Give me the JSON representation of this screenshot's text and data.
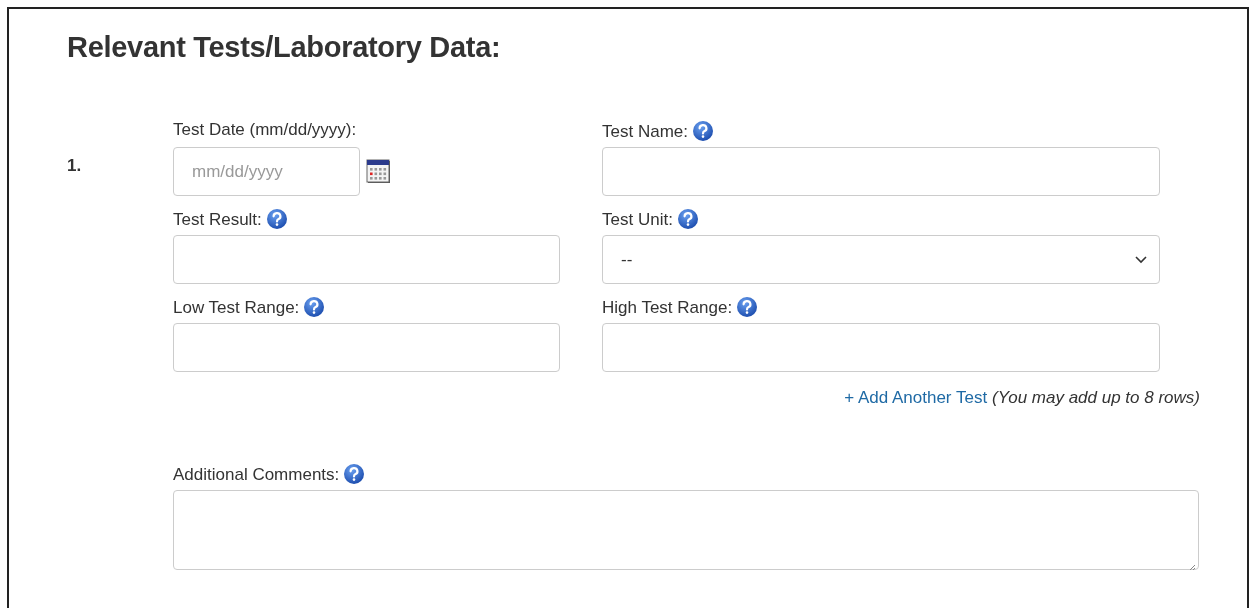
{
  "heading": "Relevant Tests/Laboratory Data:",
  "rows": [
    {
      "number": "1.",
      "fields": [
        {
          "kind": "date",
          "label": "Test Date (mm/dd/yyyy):",
          "help": false,
          "placeholder": "mm/dd/yyyy"
        },
        {
          "kind": "text",
          "label": "Test Name:",
          "help": true
        },
        {
          "kind": "text",
          "label": "Test Result:",
          "help": true
        },
        {
          "kind": "select",
          "label": "Test Unit:",
          "help": true,
          "value": "--"
        },
        {
          "kind": "text",
          "label": "Low Test Range:",
          "help": true
        },
        {
          "kind": "text",
          "label": "High Test Range:",
          "help": true
        }
      ]
    }
  ],
  "add_link": {
    "label": "+ Add Another Test",
    "note": "(You may add up to 8 rows)"
  },
  "comments": {
    "kind": "textarea",
    "label": "Additional Comments:",
    "help": true
  }
}
